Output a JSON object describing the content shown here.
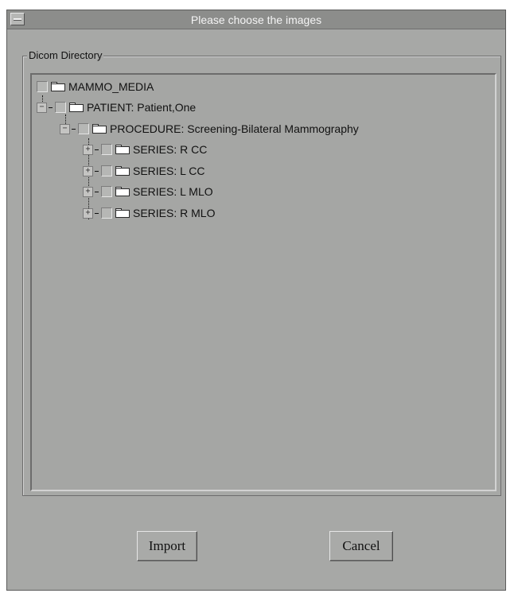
{
  "window": {
    "title": "Please choose the images"
  },
  "group": {
    "legend": "Dicom Directory"
  },
  "tree": {
    "root": {
      "label": "MAMMO_MEDIA"
    },
    "patient": {
      "label": "PATIENT: Patient,One",
      "expander": "−"
    },
    "procedure": {
      "label": "PROCEDURE: Screening-Bilateral Mammography",
      "expander": "−"
    },
    "series": [
      {
        "label": "SERIES: R CC",
        "expander": "+"
      },
      {
        "label": "SERIES: L CC",
        "expander": "+"
      },
      {
        "label": "SERIES: L MLO",
        "expander": "+"
      },
      {
        "label": "SERIES: R MLO",
        "expander": "+"
      }
    ]
  },
  "buttons": {
    "import": "Import",
    "cancel": "Cancel"
  },
  "icons": {
    "folder": "folder-icon",
    "window_menu": "window-menu-icon"
  },
  "colors": {
    "window_bg": "#a7a8a6",
    "titlebar": "#8c8d8b",
    "title_text": "#f4f4f4"
  }
}
